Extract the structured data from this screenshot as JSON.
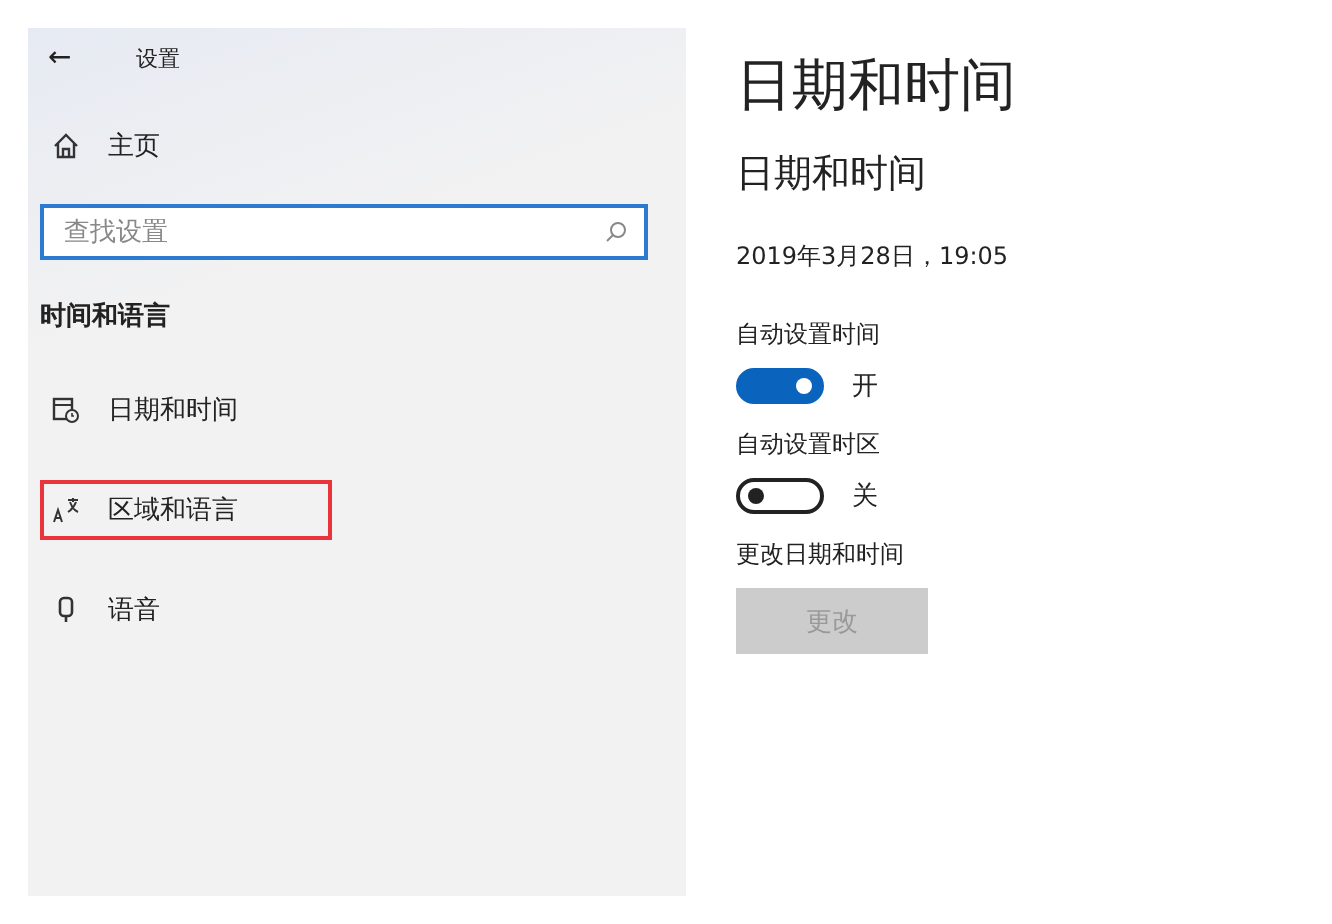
{
  "window": {
    "title": "设置",
    "back": "←"
  },
  "sidebar": {
    "home": {
      "label": "主页"
    },
    "search": {
      "placeholder": "查找设置"
    },
    "section": "时间和语言",
    "items": [
      {
        "label": "日期和时间",
        "kind": "calendar",
        "highlighted": false
      },
      {
        "label": "区域和语言",
        "kind": "language",
        "highlighted": true
      },
      {
        "label": "语音",
        "kind": "microphone",
        "highlighted": false
      }
    ]
  },
  "content": {
    "title": "日期和时间",
    "subtitle": "日期和时间",
    "datetime": "2019年3月28日，19:05",
    "toggles": [
      {
        "label": "自动设置时间",
        "on": true,
        "state_text": "开"
      },
      {
        "label": "自动设置时区",
        "on": false,
        "state_text": "关"
      }
    ],
    "change": {
      "label": "更改日期和时间",
      "button": "更改",
      "disabled": true
    }
  }
}
